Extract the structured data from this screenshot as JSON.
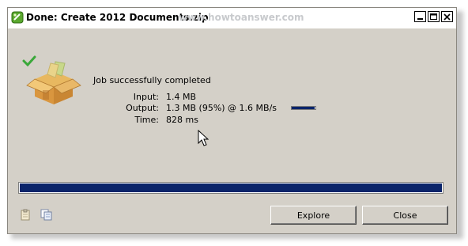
{
  "window": {
    "title": "Done: Create 2012 Documents.zip",
    "watermark": "www.howtoanswer.com"
  },
  "job": {
    "status": "Job successfully completed",
    "input_label": "Input:",
    "input_value": "1.4 MB",
    "output_label": "Output:",
    "output_value": "1.3 MB (95%) @ 1.6 MB/s",
    "output_ratio": 0.95,
    "time_label": "Time:",
    "time_value": "828 ms"
  },
  "progress": {
    "value": 1.0
  },
  "buttons": {
    "explore": "Explore",
    "close": "Close"
  },
  "icons": [
    "app-icon",
    "minimize-icon",
    "maximize-icon",
    "close-icon",
    "archive-box-icon",
    "checkmark-icon",
    "clipboard-icon",
    "copy-log-icon",
    "mouse-cursor-icon"
  ],
  "colors": {
    "progress": "#0a246a",
    "dialog": "#d4d0c8",
    "check": "#33aa33"
  }
}
